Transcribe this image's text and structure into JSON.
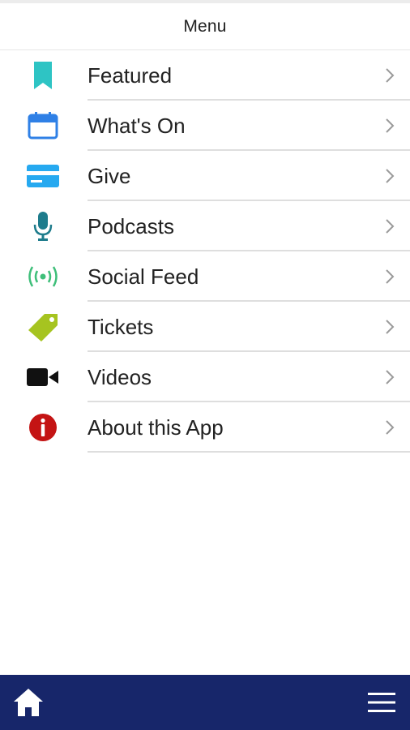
{
  "header": {
    "title": "Menu"
  },
  "menu": {
    "items": [
      {
        "label": "Featured",
        "icon": "bookmark-icon",
        "color": "#2ec4c4"
      },
      {
        "label": "What's On",
        "icon": "calendar-icon",
        "color": "#2f80e6"
      },
      {
        "label": "Give",
        "icon": "credit-card-icon",
        "color": "#26a9f0"
      },
      {
        "label": "Podcasts",
        "icon": "microphone-icon",
        "color": "#1e7c8c"
      },
      {
        "label": "Social Feed",
        "icon": "broadcast-icon",
        "color": "#3fbf7a"
      },
      {
        "label": "Tickets",
        "icon": "tag-icon",
        "color": "#a6c420"
      },
      {
        "label": "Videos",
        "icon": "video-camera-icon",
        "color": "#111111"
      },
      {
        "label": "About this App",
        "icon": "info-icon",
        "color": "#c41414"
      }
    ]
  },
  "bottom_bar": {
    "background": "#17266a",
    "home_icon": "home-icon",
    "menu_icon": "hamburger-menu-icon"
  }
}
